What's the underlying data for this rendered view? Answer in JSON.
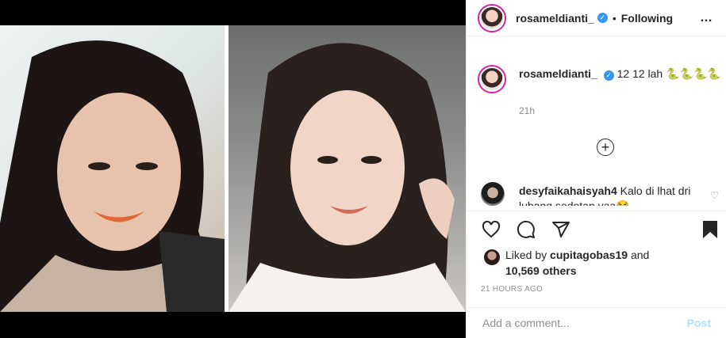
{
  "header": {
    "username": "rosameldianti_",
    "separator": "•",
    "follow_status": "Following",
    "more_icon": "…"
  },
  "caption": {
    "username": "rosameldianti_",
    "text": "12 12 lah 🐍🐍🐍🐍",
    "time": "21h"
  },
  "load_more_label": "+",
  "comment": {
    "username": "desyfaikahaisyah4",
    "text": "Kalo di lhat dri lubang sedotan yaa😂"
  },
  "likes": {
    "prefix": "Liked by",
    "liker": "cupitagobas19",
    "and": "and",
    "others": "10,569 others"
  },
  "timestamp": "21 HOURS AGO",
  "add_comment": {
    "placeholder": "Add a comment...",
    "post_label": "Post"
  },
  "colors": {
    "verified": "#3897f0",
    "post_disabled": "#b2dffc",
    "muted": "#8e8e8e"
  },
  "icons": [
    "heart-icon",
    "comment-icon",
    "share-icon",
    "bookmark-icon",
    "verified-icon",
    "more-icon",
    "plus-circle-icon"
  ]
}
